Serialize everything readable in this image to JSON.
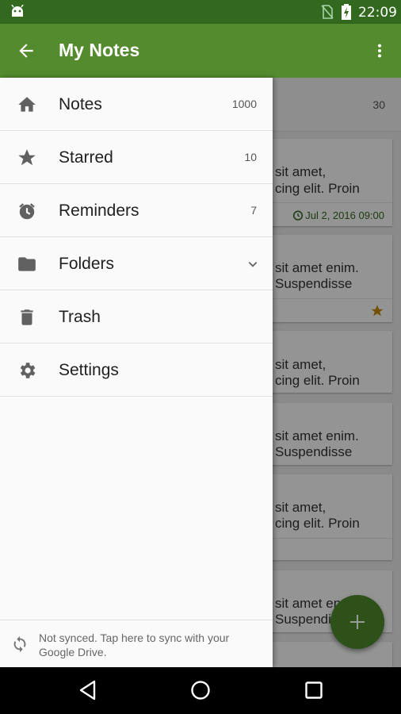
{
  "status_bar": {
    "time": "22:09"
  },
  "toolbar": {
    "title": "My Notes"
  },
  "content": {
    "header_count": "30",
    "cards": [
      {
        "line1": "sit amet,",
        "line2": "cing elit. Proin",
        "date": "Jul 2, 2016 09:00"
      },
      {
        "line1": "sit amet enim.",
        "line2": "Suspendisse"
      },
      {
        "line1": "sit amet,",
        "line2": "cing elit. Proin"
      },
      {
        "line1": "sit amet enim.",
        "line2": "Suspendisse"
      },
      {
        "line1": "sit amet,",
        "line2": "cing elit. Proin"
      },
      {
        "line1": "sit amet en",
        "line2": "Suspendi"
      }
    ]
  },
  "drawer": {
    "items": [
      {
        "label": "Notes",
        "count": "1000"
      },
      {
        "label": "Starred",
        "count": "10"
      },
      {
        "label": "Reminders",
        "count": "7"
      },
      {
        "label": "Folders"
      },
      {
        "label": "Trash"
      },
      {
        "label": "Settings"
      }
    ],
    "sync_text": "Not synced. Tap here to sync with your Google Drive."
  },
  "colors": {
    "status_bar": "#33691e",
    "toolbar": "#558b2f",
    "fab": "#2e511a",
    "accent_text": "#33691e",
    "star": "#c98a0e"
  },
  "icons": {
    "toolbar": [
      "back-arrow-icon",
      "more-vert-icon"
    ],
    "drawer": [
      "home-icon",
      "star-icon",
      "alarm-icon",
      "folder-icon",
      "trash-icon",
      "gear-icon",
      "sync-icon"
    ],
    "navbar": [
      "back-triangle-icon",
      "home-circle-icon",
      "recents-square-icon"
    ]
  }
}
